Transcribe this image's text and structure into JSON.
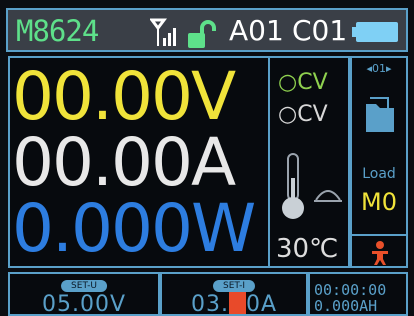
{
  "status": {
    "model": "M8624",
    "address": "A01",
    "channel": "C01",
    "icons": [
      "antenna-signal-icon",
      "unlock-icon",
      "battery-icon"
    ]
  },
  "readout": {
    "voltage": "00.00V",
    "current": "00.00A",
    "power": "0.000W"
  },
  "indicators": {
    "cv_top": "CV",
    "cv_bottom": "CV",
    "temperature": "30℃",
    "icons": [
      "thermometer-icon",
      "fan-icon"
    ]
  },
  "side": {
    "pager": "◂01▸",
    "load_label": "Load",
    "mode": "M0",
    "icons": [
      "folder-icon",
      "person-icon"
    ]
  },
  "bottom": {
    "set1_badge": "SET-U",
    "set1_value": "05.00V",
    "set2_badge": "SET-I",
    "set2_value_prefix": "03.",
    "set2_cursor": "0",
    "set2_value_suffix": "0A",
    "timer": "00:00:00",
    "capacity": "0.000AH"
  },
  "colors": {
    "voltage": "#f0e33a",
    "current": "#e8e8e8",
    "power": "#2d7de0",
    "accent": "#5aa0c9",
    "model": "#5ee08a"
  }
}
